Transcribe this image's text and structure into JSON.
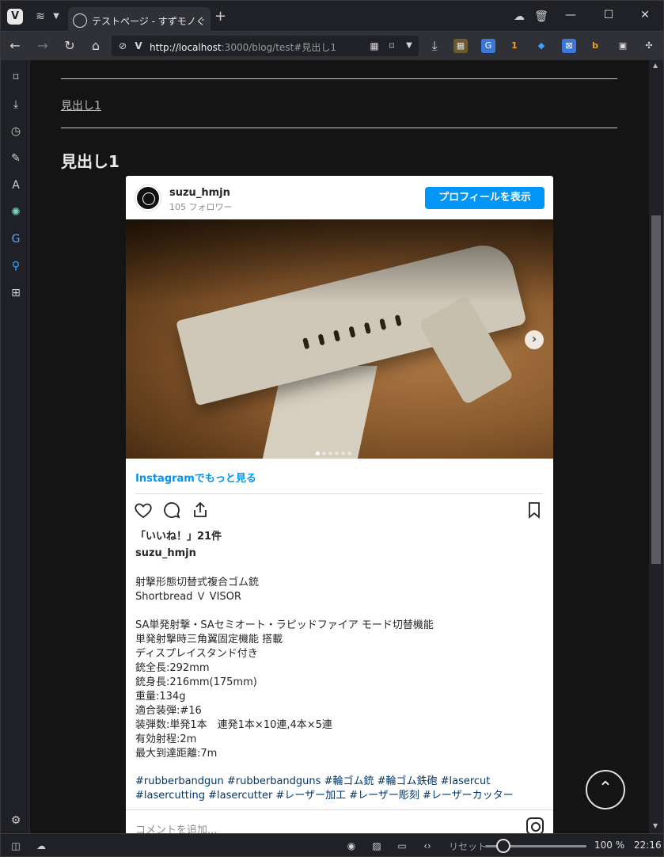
{
  "tab": {
    "title": "テストページ - すずモノぐらむ下",
    "new_tab": "+"
  },
  "address": {
    "url_host": "http://localhost",
    "url_path": ":3000/blog/test#見出し1"
  },
  "page": {
    "toc_link": "見出し1",
    "heading": "見出し1"
  },
  "instagram": {
    "username": "suzu_hmjn",
    "followers": "105 フォロワー",
    "profile_button": "プロフィールを表示",
    "more_link": "Instagramでもっと見る",
    "likes": "「いいね！」21件",
    "caption_user": "suzu_hmjn",
    "caption_lines": [
      "射撃形態切替式複合ゴム銃",
      "Shortbread Ｖ VISOR",
      "",
      "SA単発射撃・SAセミオート・ラピッドファイア モード切替機能",
      "単発射撃時三角翼固定機能 搭載",
      "ディスプレイスタンド付き",
      "銃全長:292mm",
      "銃身長:216mm(175mm)",
      "重量:134g",
      "適合装弾:#16",
      "装弾数:単発1本　連発1本×10連,4本×5連",
      "有効射程:2m",
      "最大到達距離:7m"
    ],
    "hashtags": "#rubberbandgun #rubberbandguns #輪ゴム銃 #輪ゴム鉄砲 #lasercut #lasercutting #lasercutter #レーザー加工 #レーザー彫刻 #レーザーカッター",
    "comment_placeholder": "コメントを追加...",
    "carousel_slides": 6,
    "carousel_active": 1
  },
  "statusbar": {
    "reset": "リセット",
    "zoom": "100 %",
    "time": "22:16",
    "zoom_level": 1.0
  },
  "colors": {
    "accent": "#0095f6",
    "link": "#00376b",
    "background": "#141414"
  }
}
